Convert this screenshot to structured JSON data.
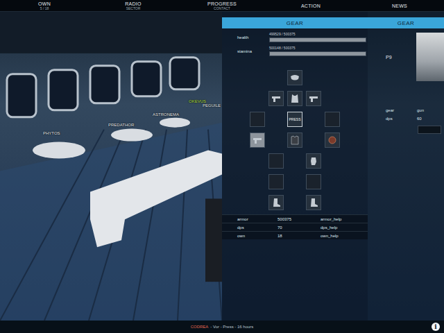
{
  "nav": [
    {
      "label": "OWN",
      "sub": "5 / 18"
    },
    {
      "label": "RADIO",
      "sub": "SECTOR"
    },
    {
      "label": "PROGRESS",
      "sub": "CONTACT"
    },
    {
      "label": "ACTION"
    },
    {
      "label": "NEWS"
    }
  ],
  "scene": {
    "labels": [
      {
        "text": "PHYTOS",
        "color": "#e8eef2"
      },
      {
        "text": "PREDATHOR",
        "color": "#e8eef2"
      },
      {
        "text": "ASTRONEMA",
        "color": "#e8eef2"
      },
      {
        "text": "OKEVUS",
        "color": "#b9e04a"
      },
      {
        "text": "PEGUILE",
        "color": "#e8eef2"
      }
    ]
  },
  "gear_panel": {
    "title": "GEAR",
    "vitals": [
      {
        "label": "health",
        "reading": "499529 / 500375",
        "level": 0.998
      },
      {
        "label": "stamina",
        "reading": "500148 / 500375",
        "level": 0.9995
      }
    ],
    "slots": [
      {
        "kind": "mask",
        "selected": false
      },
      {
        "kind": "gun",
        "selected": false
      },
      {
        "kind": "vest",
        "selected": false
      },
      {
        "kind": "gun",
        "selected": false
      },
      {
        "kind": "empty",
        "selected": false
      },
      {
        "kind": "button",
        "label": "PRESS",
        "selected": false
      },
      {
        "kind": "empty",
        "selected": false
      },
      {
        "kind": "gun",
        "selected": true
      },
      {
        "kind": "jacket",
        "selected": false
      },
      {
        "kind": "orb",
        "selected": false
      },
      {
        "kind": "empty",
        "selected": false
      },
      {
        "kind": "glove",
        "selected": false
      },
      {
        "kind": "empty",
        "selected": false
      },
      {
        "kind": "empty",
        "selected": false
      },
      {
        "kind": "boot",
        "selected": false
      },
      {
        "kind": "boot",
        "selected": false
      }
    ],
    "stats": [
      {
        "label": "armor",
        "value": "500375",
        "help": "armor_help"
      },
      {
        "label": "dps",
        "value": "70",
        "help": "dps_help"
      },
      {
        "label": "own",
        "value": "18",
        "help": "own_help"
      }
    ]
  },
  "side_panel": {
    "title": "GEAR",
    "name": "P9",
    "rows": [
      {
        "label": "gear",
        "value": "gun"
      },
      {
        "label": "dps",
        "value": "60"
      }
    ]
  },
  "status_bar": {
    "name": "CODREA",
    "text": "- Vor - Press - 16 hours"
  },
  "info_button": "i"
}
